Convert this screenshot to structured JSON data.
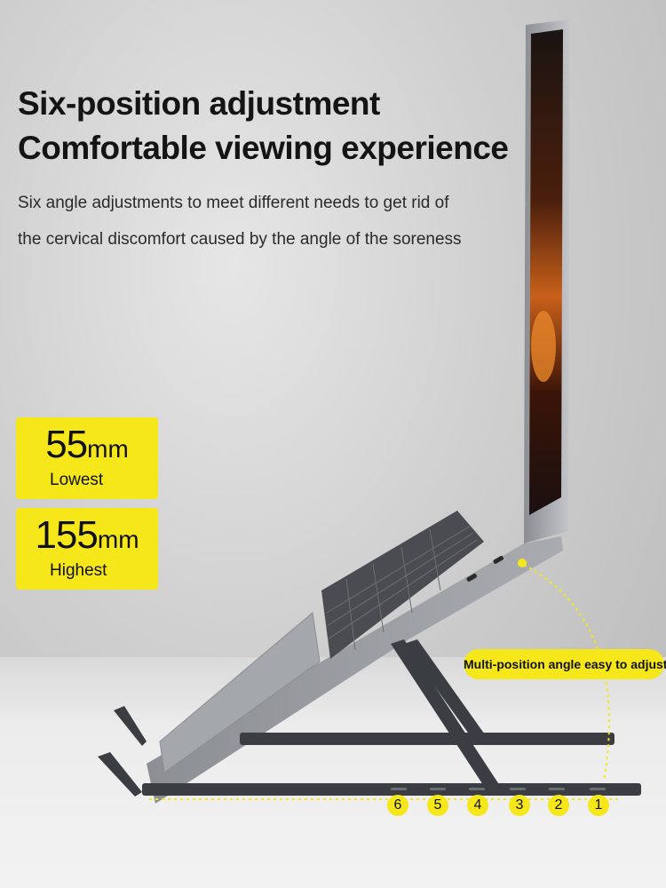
{
  "headline": {
    "line1": "Six-position adjustment",
    "line2": "Comfortable viewing experience"
  },
  "description": {
    "line1": "Six angle adjustments to meet different needs to get rid of",
    "line2": "the cervical discomfort caused by the angle of the soreness"
  },
  "specs": [
    {
      "value": "55",
      "unit": "mm",
      "label": "Lowest"
    },
    {
      "value": "155",
      "unit": "mm",
      "label": "Highest"
    }
  ],
  "callout": "Multi-position angle easy to adjust",
  "positions": [
    "6",
    "5",
    "4",
    "3",
    "2",
    "1"
  ],
  "colors": {
    "accent": "#f6e71b",
    "stand": "#3a3d42",
    "laptop": "#9a9da3"
  }
}
